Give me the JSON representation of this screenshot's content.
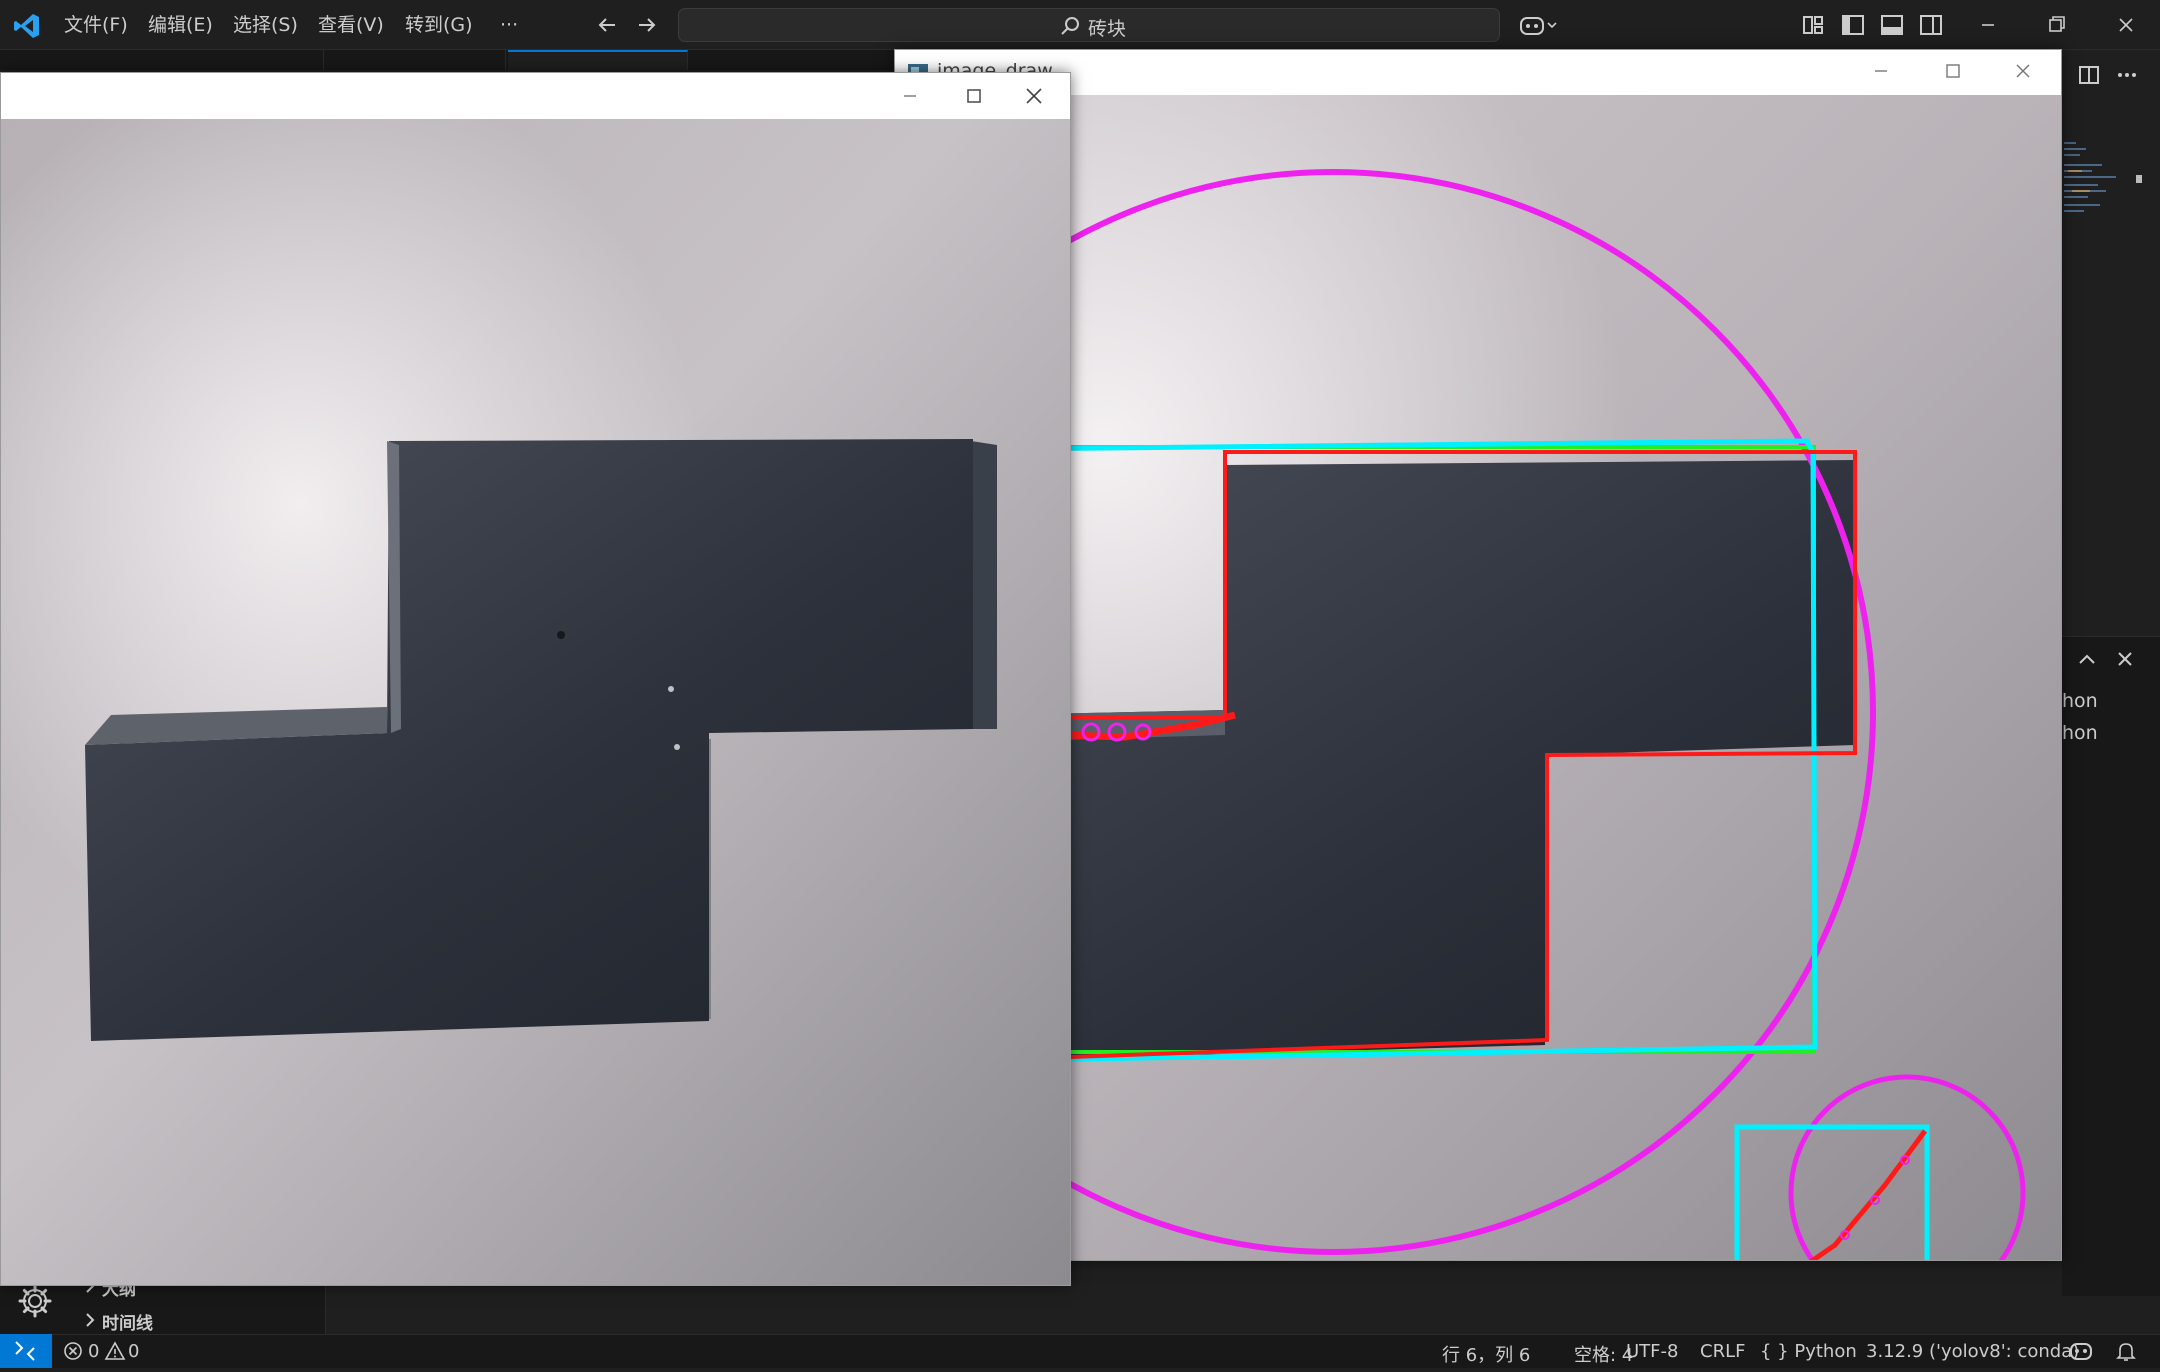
{
  "menu": {
    "file": "文件(F)",
    "edit": "编辑(E)",
    "select": "选择(S)",
    "view": "查看(V)",
    "goto": "转到(G)",
    "more": "···"
  },
  "command_center": {
    "text": "砖块"
  },
  "windows": {
    "draw_title": "image_draw",
    "original_title": ""
  },
  "sidebar": {
    "outline": "大纲",
    "timeline": "时间线"
  },
  "panel": {
    "line1": "hon",
    "line2": "hon"
  },
  "statusbar": {
    "errors": "0",
    "warnings": "0",
    "position": "行 6，列 6",
    "spaces": "空格: 4",
    "encoding": "UTF-8",
    "eol": "CRLF",
    "language_mode": "{ } Python",
    "interpreter": "3.12.9 ('yolov8': conda)"
  },
  "colors": {
    "accent": "#0078d4",
    "contour_red": "#ff1a1a",
    "bbox_green": "#22ee22",
    "rect_cyan": "#00f0ff",
    "circle_magenta": "#ee22ee"
  }
}
